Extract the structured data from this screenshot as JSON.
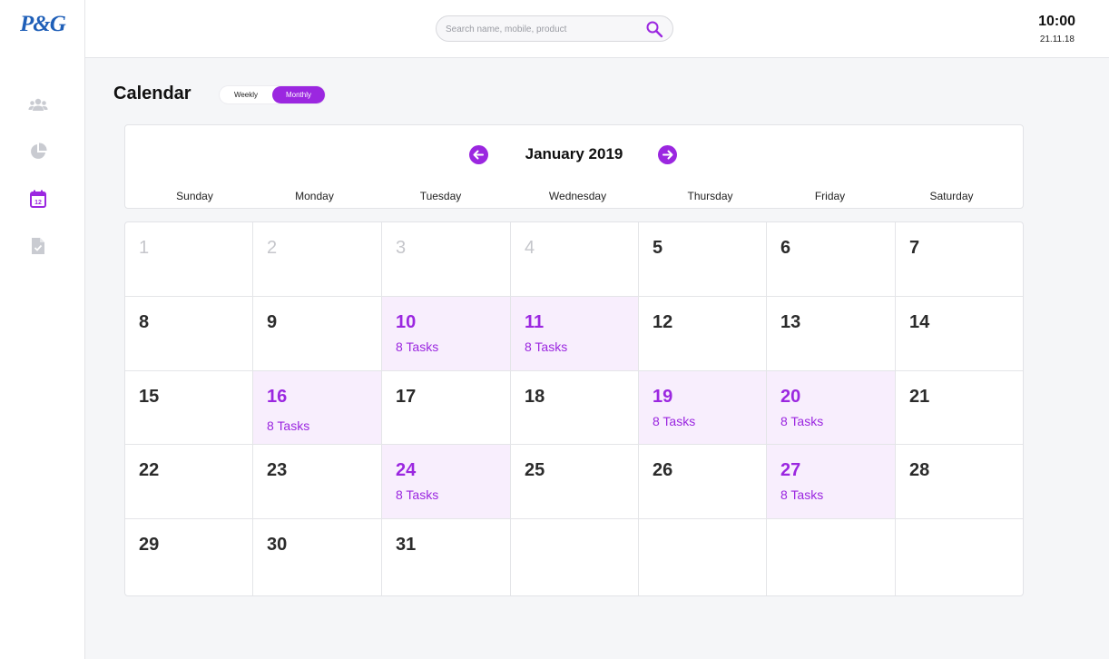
{
  "app": {
    "logo": "P&G"
  },
  "sidebar": {
    "items": [
      {
        "name": "users",
        "icon": "users-icon",
        "active": false
      },
      {
        "name": "analytics",
        "icon": "pie-chart-icon",
        "active": false
      },
      {
        "name": "calendar",
        "icon": "calendar-icon",
        "active": true
      },
      {
        "name": "reports",
        "icon": "document-check-icon",
        "active": false
      }
    ]
  },
  "search": {
    "placeholder": "Search name, mobile, product",
    "value": ""
  },
  "clock": {
    "time": "10:00",
    "date": "21.11.18"
  },
  "page": {
    "title": "Calendar",
    "view_toggle": {
      "weekly": "Weekly",
      "monthly": "Monthly",
      "selected": "Monthly"
    }
  },
  "calendar": {
    "month_label": "January 2019",
    "weekdays": [
      "Sunday",
      "Monday",
      "Tuesday",
      "Wednesday",
      "Thursday",
      "Friday",
      "Saturday"
    ],
    "weeks": [
      [
        {
          "day": "1",
          "state": "muted"
        },
        {
          "day": "2",
          "state": "muted"
        },
        {
          "day": "3",
          "state": "muted"
        },
        {
          "day": "4",
          "state": "muted"
        },
        {
          "day": "5"
        },
        {
          "day": "6"
        },
        {
          "day": "7"
        }
      ],
      [
        {
          "day": "8"
        },
        {
          "day": "9"
        },
        {
          "day": "10",
          "tasks": "8 Tasks"
        },
        {
          "day": "11",
          "tasks": "8 Tasks"
        },
        {
          "day": "12"
        },
        {
          "day": "13"
        },
        {
          "day": "14"
        }
      ],
      [
        {
          "day": "15"
        },
        {
          "day": "16",
          "tasks": "8 Tasks"
        },
        {
          "day": "17"
        },
        {
          "day": "18"
        },
        {
          "day": "19",
          "tasks": "8 Tasks"
        },
        {
          "day": "20",
          "tasks": "8 Tasks"
        },
        {
          "day": "21"
        }
      ],
      [
        {
          "day": "22"
        },
        {
          "day": "23"
        },
        {
          "day": "24",
          "tasks": "8 Tasks"
        },
        {
          "day": "25"
        },
        {
          "day": "26"
        },
        {
          "day": "27",
          "tasks": "8 Tasks"
        },
        {
          "day": "28"
        }
      ],
      [
        {
          "day": "29"
        },
        {
          "day": "30"
        },
        {
          "day": "31"
        },
        {
          "day": ""
        },
        {
          "day": ""
        },
        {
          "day": ""
        },
        {
          "day": ""
        }
      ]
    ]
  },
  "colors": {
    "accent": "#9b27e0",
    "highlight_bg": "#f8eefd",
    "brand_blue": "#1f5fb8",
    "muted_text": "#c5c6cb"
  }
}
